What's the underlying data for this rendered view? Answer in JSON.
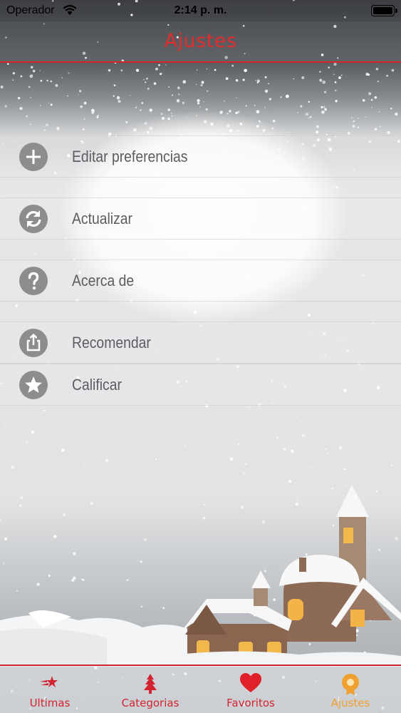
{
  "status_bar": {
    "carrier": "Operador",
    "time": "2:14 p. m."
  },
  "nav": {
    "title": "Ajustes"
  },
  "settings": {
    "items": [
      {
        "label": "Editar preferencias",
        "icon": "plus-icon"
      },
      {
        "label": "Actualizar",
        "icon": "refresh-icon"
      },
      {
        "label": "Acerca de",
        "icon": "question-icon"
      },
      {
        "label": "Recomendar",
        "icon": "share-icon"
      },
      {
        "label": "Calificar",
        "icon": "star-icon"
      }
    ]
  },
  "tabs": [
    {
      "label": "Ultimas",
      "icon": "shooting-star-icon",
      "active": false
    },
    {
      "label": "Categorias",
      "icon": "christmas-tree-icon",
      "active": false
    },
    {
      "label": "Favoritos",
      "icon": "heart-icon",
      "active": false
    },
    {
      "label": "Ajustes",
      "icon": "gear-icon",
      "active": true
    }
  ],
  "colors": {
    "accent_red": "#d2252f",
    "active_tab": "#f0a030",
    "icon_gray": "#8d8d8d",
    "label_gray": "#5b5d60"
  }
}
